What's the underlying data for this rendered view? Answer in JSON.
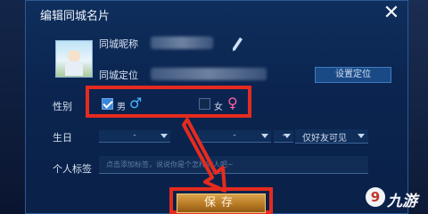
{
  "dialog": {
    "title": "编辑同城名片",
    "close_glyph": "✕"
  },
  "profile": {
    "nickname_label": "同城昵称",
    "location_label": "同城定位",
    "set_location_button": "设置定位"
  },
  "gender": {
    "label": "性别",
    "male_label": "男",
    "female_label": "女",
    "male_checked": true,
    "female_checked": false,
    "male_symbol": "♂",
    "female_symbol": "♀"
  },
  "birthday": {
    "label": "生日",
    "year_value": "-",
    "month_value": "-",
    "day_value": "-",
    "visibility_value": "仅好友可见"
  },
  "tags": {
    "label": "个人标签",
    "placeholder": "点击添加标签，说说你是个怎样的人吧~"
  },
  "save_button": {
    "label": "保存"
  },
  "watermark": {
    "icon": "9",
    "text": "九游"
  },
  "colors": {
    "dialog_bg": "#0b2550",
    "highlight_red": "#e52b1f",
    "checkbox_blue": "#3a86d8",
    "male_blue": "#47b6ff",
    "female_pink": "#ff5fa0",
    "save_gold": "#b97a24"
  }
}
